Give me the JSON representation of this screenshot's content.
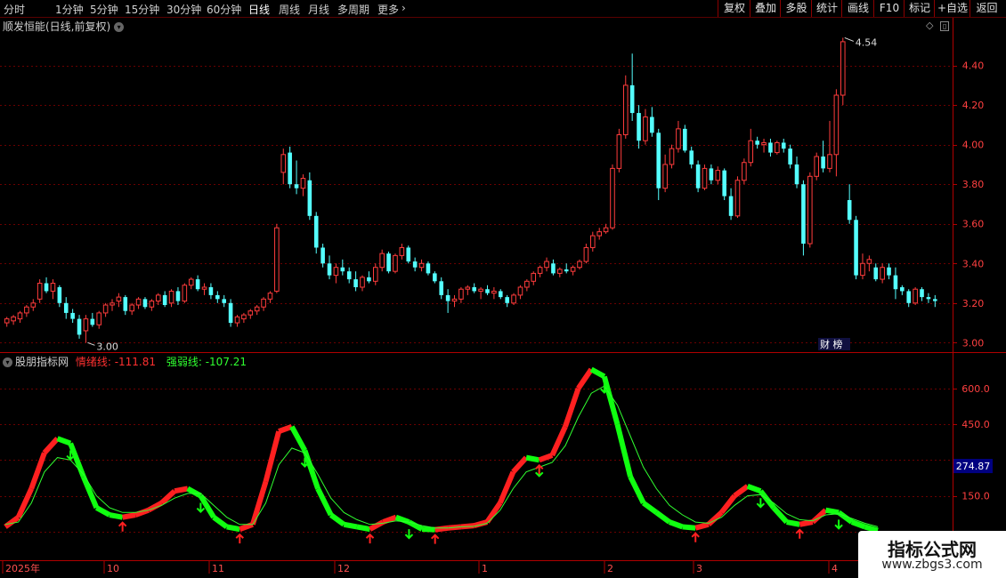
{
  "toolbar": {
    "timeframes": [
      "分时",
      "1分钟",
      "5分钟",
      "15分钟",
      "30分钟",
      "60分钟",
      "日线",
      "周线",
      "月线",
      "多周期",
      "更多"
    ],
    "active": "日线",
    "more_arrow": "›",
    "right_buttons": [
      "复权",
      "叠加",
      "多股",
      "统计",
      "画线",
      "F10",
      "标记",
      "+自选",
      "返回"
    ]
  },
  "price_panel": {
    "title": "顺发恒能(日线,前复权)",
    "y_ticks": [
      "4.40",
      "4.20",
      "4.00",
      "3.80",
      "3.60",
      "3.40",
      "3.20",
      "3.00"
    ],
    "high_label": "4.54",
    "low_label": "3.00",
    "badge": "财 榜",
    "colors": {
      "up": "#ff3c3c",
      "down": "#54ffff",
      "grid": "#7a0000",
      "axis": "#b00000"
    }
  },
  "indicator_panel": {
    "name": "股朋指标网",
    "line1_label": "情绪线: -111.81",
    "line2_label": "强弱线: -107.21",
    "y_ticks": [
      "600.0",
      "450.0",
      "150.0"
    ],
    "current_value": "274.87",
    "colors": {
      "up": "#ff2020",
      "down": "#10ff10",
      "line": "#30ff30",
      "marker_bg": "#000080"
    }
  },
  "date_axis": {
    "labels": [
      "2025年",
      "10",
      "11",
      "12",
      "1",
      "2",
      "3",
      "4"
    ]
  },
  "watermark": {
    "title": "指标公式网",
    "url": "www.zbgs3.com"
  },
  "chart_data": [
    {
      "type": "candlestick",
      "title": "顺发恒能(日线,前复权)",
      "ylim": [
        2.97,
        4.56
      ],
      "y_ticks": [
        3.0,
        3.2,
        3.4,
        3.6,
        3.8,
        4.0,
        4.2,
        4.4
      ],
      "grid": true,
      "annotations": [
        {
          "text": "4.54"
        },
        {
          "text": "3.00"
        }
      ],
      "ohlc": [
        [
          3.1,
          3.13,
          3.08,
          3.12
        ],
        [
          3.11,
          3.14,
          3.09,
          3.13
        ],
        [
          3.12,
          3.16,
          3.1,
          3.15
        ],
        [
          3.15,
          3.19,
          3.13,
          3.18
        ],
        [
          3.18,
          3.22,
          3.16,
          3.2
        ],
        [
          3.22,
          3.32,
          3.2,
          3.3
        ],
        [
          3.3,
          3.33,
          3.25,
          3.26
        ],
        [
          3.26,
          3.32,
          3.22,
          3.3
        ],
        [
          3.28,
          3.29,
          3.18,
          3.2
        ],
        [
          3.2,
          3.23,
          3.12,
          3.15
        ],
        [
          3.15,
          3.17,
          3.1,
          3.12
        ],
        [
          3.12,
          3.14,
          3.02,
          3.04
        ],
        [
          3.06,
          3.14,
          3.0,
          3.12
        ],
        [
          3.12,
          3.15,
          3.08,
          3.09
        ],
        [
          3.09,
          3.16,
          3.07,
          3.15
        ],
        [
          3.15,
          3.2,
          3.13,
          3.19
        ],
        [
          3.19,
          3.22,
          3.16,
          3.2
        ],
        [
          3.21,
          3.25,
          3.18,
          3.23
        ],
        [
          3.23,
          3.24,
          3.14,
          3.16
        ],
        [
          3.16,
          3.2,
          3.14,
          3.19
        ],
        [
          3.19,
          3.23,
          3.17,
          3.22
        ],
        [
          3.22,
          3.23,
          3.17,
          3.18
        ],
        [
          3.18,
          3.22,
          3.16,
          3.21
        ],
        [
          3.21,
          3.25,
          3.19,
          3.24
        ],
        [
          3.24,
          3.26,
          3.18,
          3.19
        ],
        [
          3.2,
          3.27,
          3.18,
          3.26
        ],
        [
          3.26,
          3.28,
          3.19,
          3.21
        ],
        [
          3.21,
          3.3,
          3.2,
          3.29
        ],
        [
          3.29,
          3.33,
          3.27,
          3.32
        ],
        [
          3.32,
          3.34,
          3.26,
          3.27
        ],
        [
          3.27,
          3.3,
          3.24,
          3.28
        ],
        [
          3.28,
          3.3,
          3.22,
          3.24
        ],
        [
          3.24,
          3.26,
          3.2,
          3.22
        ],
        [
          3.22,
          3.24,
          3.18,
          3.2
        ],
        [
          3.2,
          3.22,
          3.08,
          3.1
        ],
        [
          3.1,
          3.14,
          3.08,
          3.13
        ],
        [
          3.12,
          3.15,
          3.1,
          3.14
        ],
        [
          3.14,
          3.17,
          3.12,
          3.16
        ],
        [
          3.16,
          3.19,
          3.14,
          3.18
        ],
        [
          3.18,
          3.23,
          3.16,
          3.22
        ],
        [
          3.22,
          3.26,
          3.2,
          3.25
        ],
        [
          3.26,
          3.6,
          3.25,
          3.58
        ],
        [
          3.86,
          3.98,
          3.8,
          3.95
        ],
        [
          3.96,
          3.99,
          3.78,
          3.8
        ],
        [
          3.8,
          3.92,
          3.75,
          3.78
        ],
        [
          3.78,
          3.85,
          3.74,
          3.83
        ],
        [
          3.82,
          3.86,
          3.62,
          3.64
        ],
        [
          3.64,
          3.66,
          3.45,
          3.48
        ],
        [
          3.48,
          3.5,
          3.38,
          3.4
        ],
        [
          3.4,
          3.44,
          3.32,
          3.34
        ],
        [
          3.34,
          3.4,
          3.3,
          3.38
        ],
        [
          3.38,
          3.42,
          3.34,
          3.36
        ],
        [
          3.36,
          3.38,
          3.3,
          3.32
        ],
        [
          3.32,
          3.36,
          3.26,
          3.28
        ],
        [
          3.28,
          3.34,
          3.26,
          3.33
        ],
        [
          3.33,
          3.36,
          3.3,
          3.31
        ],
        [
          3.31,
          3.4,
          3.29,
          3.38
        ],
        [
          3.38,
          3.47,
          3.36,
          3.45
        ],
        [
          3.45,
          3.46,
          3.35,
          3.36
        ],
        [
          3.36,
          3.45,
          3.35,
          3.44
        ],
        [
          3.44,
          3.5,
          3.42,
          3.48
        ],
        [
          3.48,
          3.49,
          3.4,
          3.41
        ],
        [
          3.41,
          3.43,
          3.36,
          3.38
        ],
        [
          3.38,
          3.42,
          3.36,
          3.4
        ],
        [
          3.4,
          3.41,
          3.34,
          3.35
        ],
        [
          3.35,
          3.36,
          3.3,
          3.31
        ],
        [
          3.31,
          3.33,
          3.22,
          3.24
        ],
        [
          3.24,
          3.27,
          3.15,
          3.21
        ],
        [
          3.21,
          3.24,
          3.18,
          3.22
        ],
        [
          3.22,
          3.28,
          3.2,
          3.27
        ],
        [
          3.27,
          3.29,
          3.24,
          3.28
        ],
        [
          3.28,
          3.3,
          3.25,
          3.26
        ],
        [
          3.26,
          3.28,
          3.22,
          3.27
        ],
        [
          3.27,
          3.29,
          3.24,
          3.25
        ],
        [
          3.25,
          3.28,
          3.22,
          3.26
        ],
        [
          3.26,
          3.27,
          3.22,
          3.23
        ],
        [
          3.23,
          3.24,
          3.18,
          3.2
        ],
        [
          3.2,
          3.25,
          3.19,
          3.24
        ],
        [
          3.24,
          3.29,
          3.22,
          3.28
        ],
        [
          3.28,
          3.32,
          3.26,
          3.31
        ],
        [
          3.31,
          3.36,
          3.29,
          3.35
        ],
        [
          3.35,
          3.39,
          3.33,
          3.38
        ],
        [
          3.38,
          3.43,
          3.36,
          3.41
        ],
        [
          3.4,
          3.42,
          3.34,
          3.35
        ],
        [
          3.35,
          3.38,
          3.33,
          3.37
        ],
        [
          3.37,
          3.4,
          3.35,
          3.36
        ],
        [
          3.36,
          3.39,
          3.34,
          3.38
        ],
        [
          3.38,
          3.42,
          3.37,
          3.41
        ],
        [
          3.41,
          3.5,
          3.4,
          3.48
        ],
        [
          3.48,
          3.56,
          3.46,
          3.54
        ],
        [
          3.54,
          3.58,
          3.52,
          3.56
        ],
        [
          3.56,
          3.6,
          3.55,
          3.58
        ],
        [
          3.58,
          3.9,
          3.57,
          3.88
        ],
        [
          3.88,
          4.08,
          3.86,
          4.05
        ],
        [
          4.05,
          4.35,
          4.03,
          4.3
        ],
        [
          4.3,
          4.46,
          4.12,
          4.16
        ],
        [
          4.16,
          4.2,
          3.98,
          4.02
        ],
        [
          4.02,
          4.18,
          4.0,
          4.14
        ],
        [
          4.14,
          4.19,
          4.04,
          4.06
        ],
        [
          4.06,
          4.08,
          3.72,
          3.78
        ],
        [
          3.78,
          3.95,
          3.76,
          3.9
        ],
        [
          3.9,
          4.0,
          3.88,
          3.98
        ],
        [
          3.98,
          4.12,
          3.96,
          4.08
        ],
        [
          4.08,
          4.1,
          3.96,
          3.97
        ],
        [
          3.97,
          3.99,
          3.88,
          3.9
        ],
        [
          3.9,
          3.92,
          3.76,
          3.78
        ],
        [
          3.78,
          3.9,
          3.77,
          3.88
        ],
        [
          3.88,
          3.9,
          3.8,
          3.82
        ],
        [
          3.82,
          3.89,
          3.8,
          3.87
        ],
        [
          3.87,
          3.88,
          3.72,
          3.74
        ],
        [
          3.74,
          3.78,
          3.62,
          3.64
        ],
        [
          3.64,
          3.84,
          3.63,
          3.82
        ],
        [
          3.82,
          3.93,
          3.8,
          3.91
        ],
        [
          3.91,
          4.08,
          3.89,
          4.02
        ],
        [
          4.02,
          4.04,
          3.98,
          4.0
        ],
        [
          4.0,
          4.03,
          3.96,
          4.01
        ],
        [
          4.01,
          4.03,
          3.94,
          3.96
        ],
        [
          3.96,
          4.02,
          3.95,
          4.01
        ],
        [
          4.01,
          4.03,
          3.96,
          3.98
        ],
        [
          3.98,
          4.0,
          3.88,
          3.9
        ],
        [
          3.9,
          3.94,
          3.78,
          3.8
        ],
        [
          3.8,
          3.82,
          3.44,
          3.5
        ],
        [
          3.5,
          3.86,
          3.48,
          3.84
        ],
        [
          3.84,
          3.96,
          3.82,
          3.94
        ],
        [
          3.94,
          4.02,
          3.86,
          3.88
        ],
        [
          3.88,
          4.12,
          3.86,
          3.95
        ],
        [
          3.95,
          4.28,
          3.84,
          4.25
        ],
        [
          4.25,
          4.54,
          4.2,
          4.52
        ],
        [
          3.72,
          3.8,
          3.6,
          3.62
        ],
        [
          3.62,
          3.64,
          3.32,
          3.34
        ],
        [
          3.34,
          3.45,
          3.32,
          3.4
        ],
        [
          3.4,
          3.44,
          3.36,
          3.42
        ],
        [
          3.38,
          3.4,
          3.31,
          3.32
        ],
        [
          3.32,
          3.4,
          3.3,
          3.38
        ],
        [
          3.38,
          3.4,
          3.32,
          3.34
        ],
        [
          3.34,
          3.38,
          3.22,
          3.27
        ],
        [
          3.28,
          3.29,
          3.24,
          3.26
        ],
        [
          3.26,
          3.27,
          3.18,
          3.2
        ],
        [
          3.2,
          3.28,
          3.19,
          3.27
        ],
        [
          3.27,
          3.28,
          3.21,
          3.23
        ],
        [
          3.23,
          3.25,
          3.2,
          3.22
        ],
        [
          3.22,
          3.24,
          3.18,
          3.21
        ]
      ]
    },
    {
      "type": "line",
      "series": [
        {
          "name": "情绪线",
          "values": [
            20,
            60,
            180,
            330,
            390,
            370,
            230,
            100,
            70,
            60,
            70,
            90,
            120,
            170,
            180,
            150,
            60,
            20,
            10,
            30,
            210,
            420,
            440,
            340,
            180,
            70,
            30,
            20,
            10,
            40,
            60,
            40,
            10,
            8,
            15,
            20,
            25,
            40,
            120,
            250,
            310,
            300,
            320,
            440,
            600,
            680,
            650,
            450,
            230,
            120,
            80,
            40,
            20,
            15,
            30,
            80,
            150,
            190,
            170,
            100,
            40,
            30,
            40,
            90,
            80,
            40,
            20,
            5
          ]
        },
        {
          "name": "强弱线",
          "values": [
            30,
            40,
            120,
            250,
            310,
            300,
            240,
            150,
            100,
            80,
            80,
            90,
            110,
            140,
            160,
            160,
            110,
            60,
            30,
            30,
            120,
            280,
            350,
            330,
            240,
            140,
            80,
            50,
            30,
            35,
            45,
            40,
            25,
            15,
            15,
            20,
            22,
            35,
            90,
            180,
            250,
            270,
            290,
            360,
            480,
            580,
            610,
            530,
            400,
            270,
            180,
            110,
            70,
            40,
            35,
            60,
            110,
            150,
            155,
            120,
            75,
            50,
            45,
            70,
            75,
            55,
            35,
            20
          ]
        }
      ],
      "y_ticks": [
        600,
        450,
        150
      ],
      "values_shown": {
        "情绪线": -111.81,
        "强弱线": -107.21,
        "cursor": 274.87
      }
    }
  ]
}
